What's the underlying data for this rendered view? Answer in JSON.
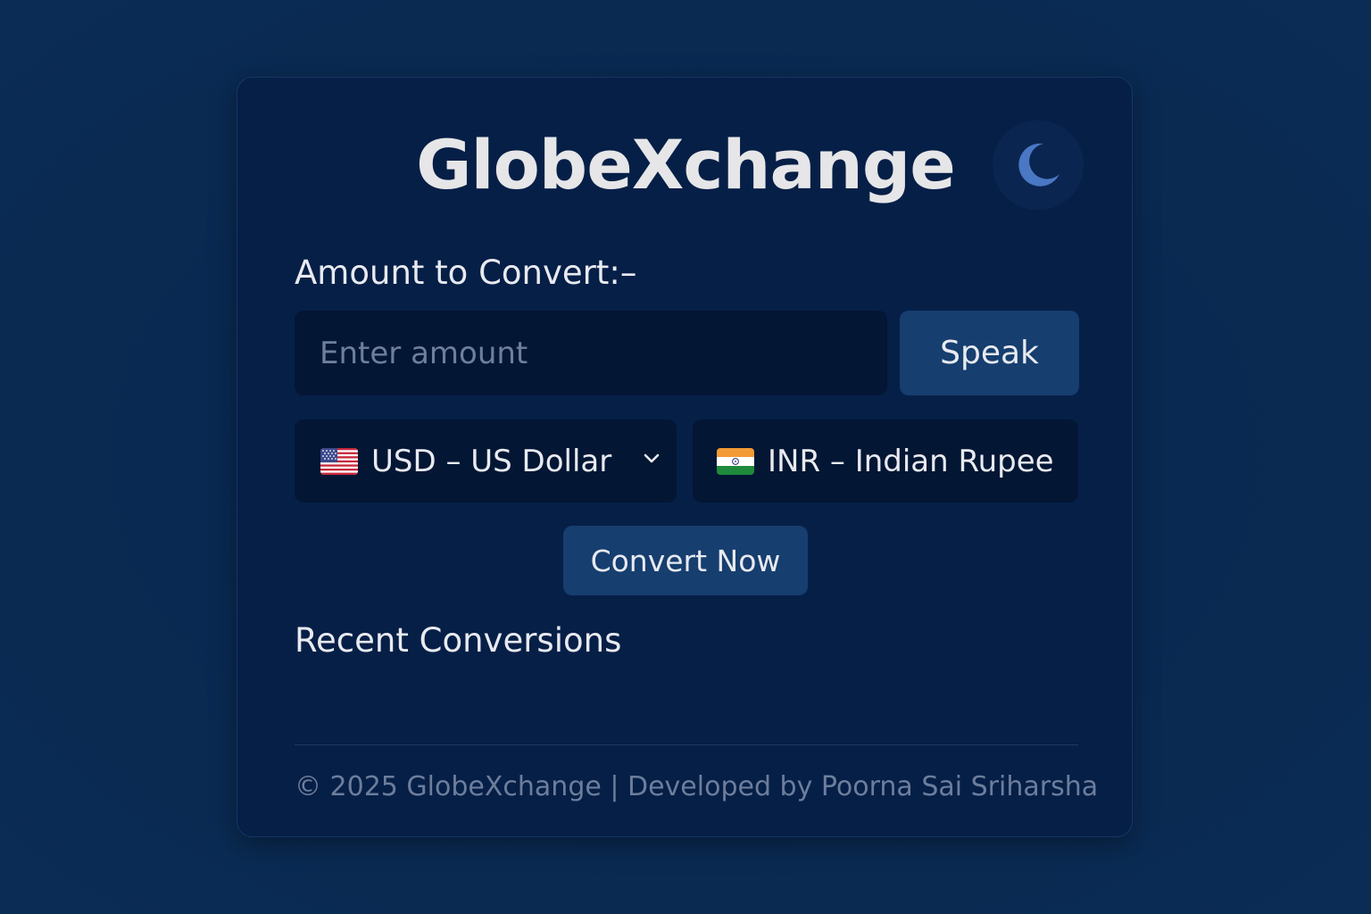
{
  "app": {
    "title": "GlobeXchange"
  },
  "theme_toggle": {
    "icon": "moon-icon",
    "icon_color": "#4a78c4"
  },
  "converter": {
    "amount_label": "Amount to Convert:–",
    "amount_placeholder": "Enter amount",
    "amount_value": "",
    "speak_label": "Speak",
    "from_currency": {
      "flag": "us-flag-icon",
      "label": "USD – US Dollar"
    },
    "to_currency": {
      "flag": "india-flag-icon",
      "label": "INR – Indian Rupee"
    },
    "convert_label": "Convert Now"
  },
  "recent": {
    "heading": "Recent Conversions",
    "items": []
  },
  "footer": {
    "text": "© 2025 GlobeXchange | Developed by Poorna Sai Sriharsha"
  },
  "colors": {
    "background": "#0a2a52",
    "card": "#061f47",
    "input": "#031634",
    "button": "#163e6f",
    "text": "#e8eaf0",
    "muted": "#6c7e9c"
  }
}
